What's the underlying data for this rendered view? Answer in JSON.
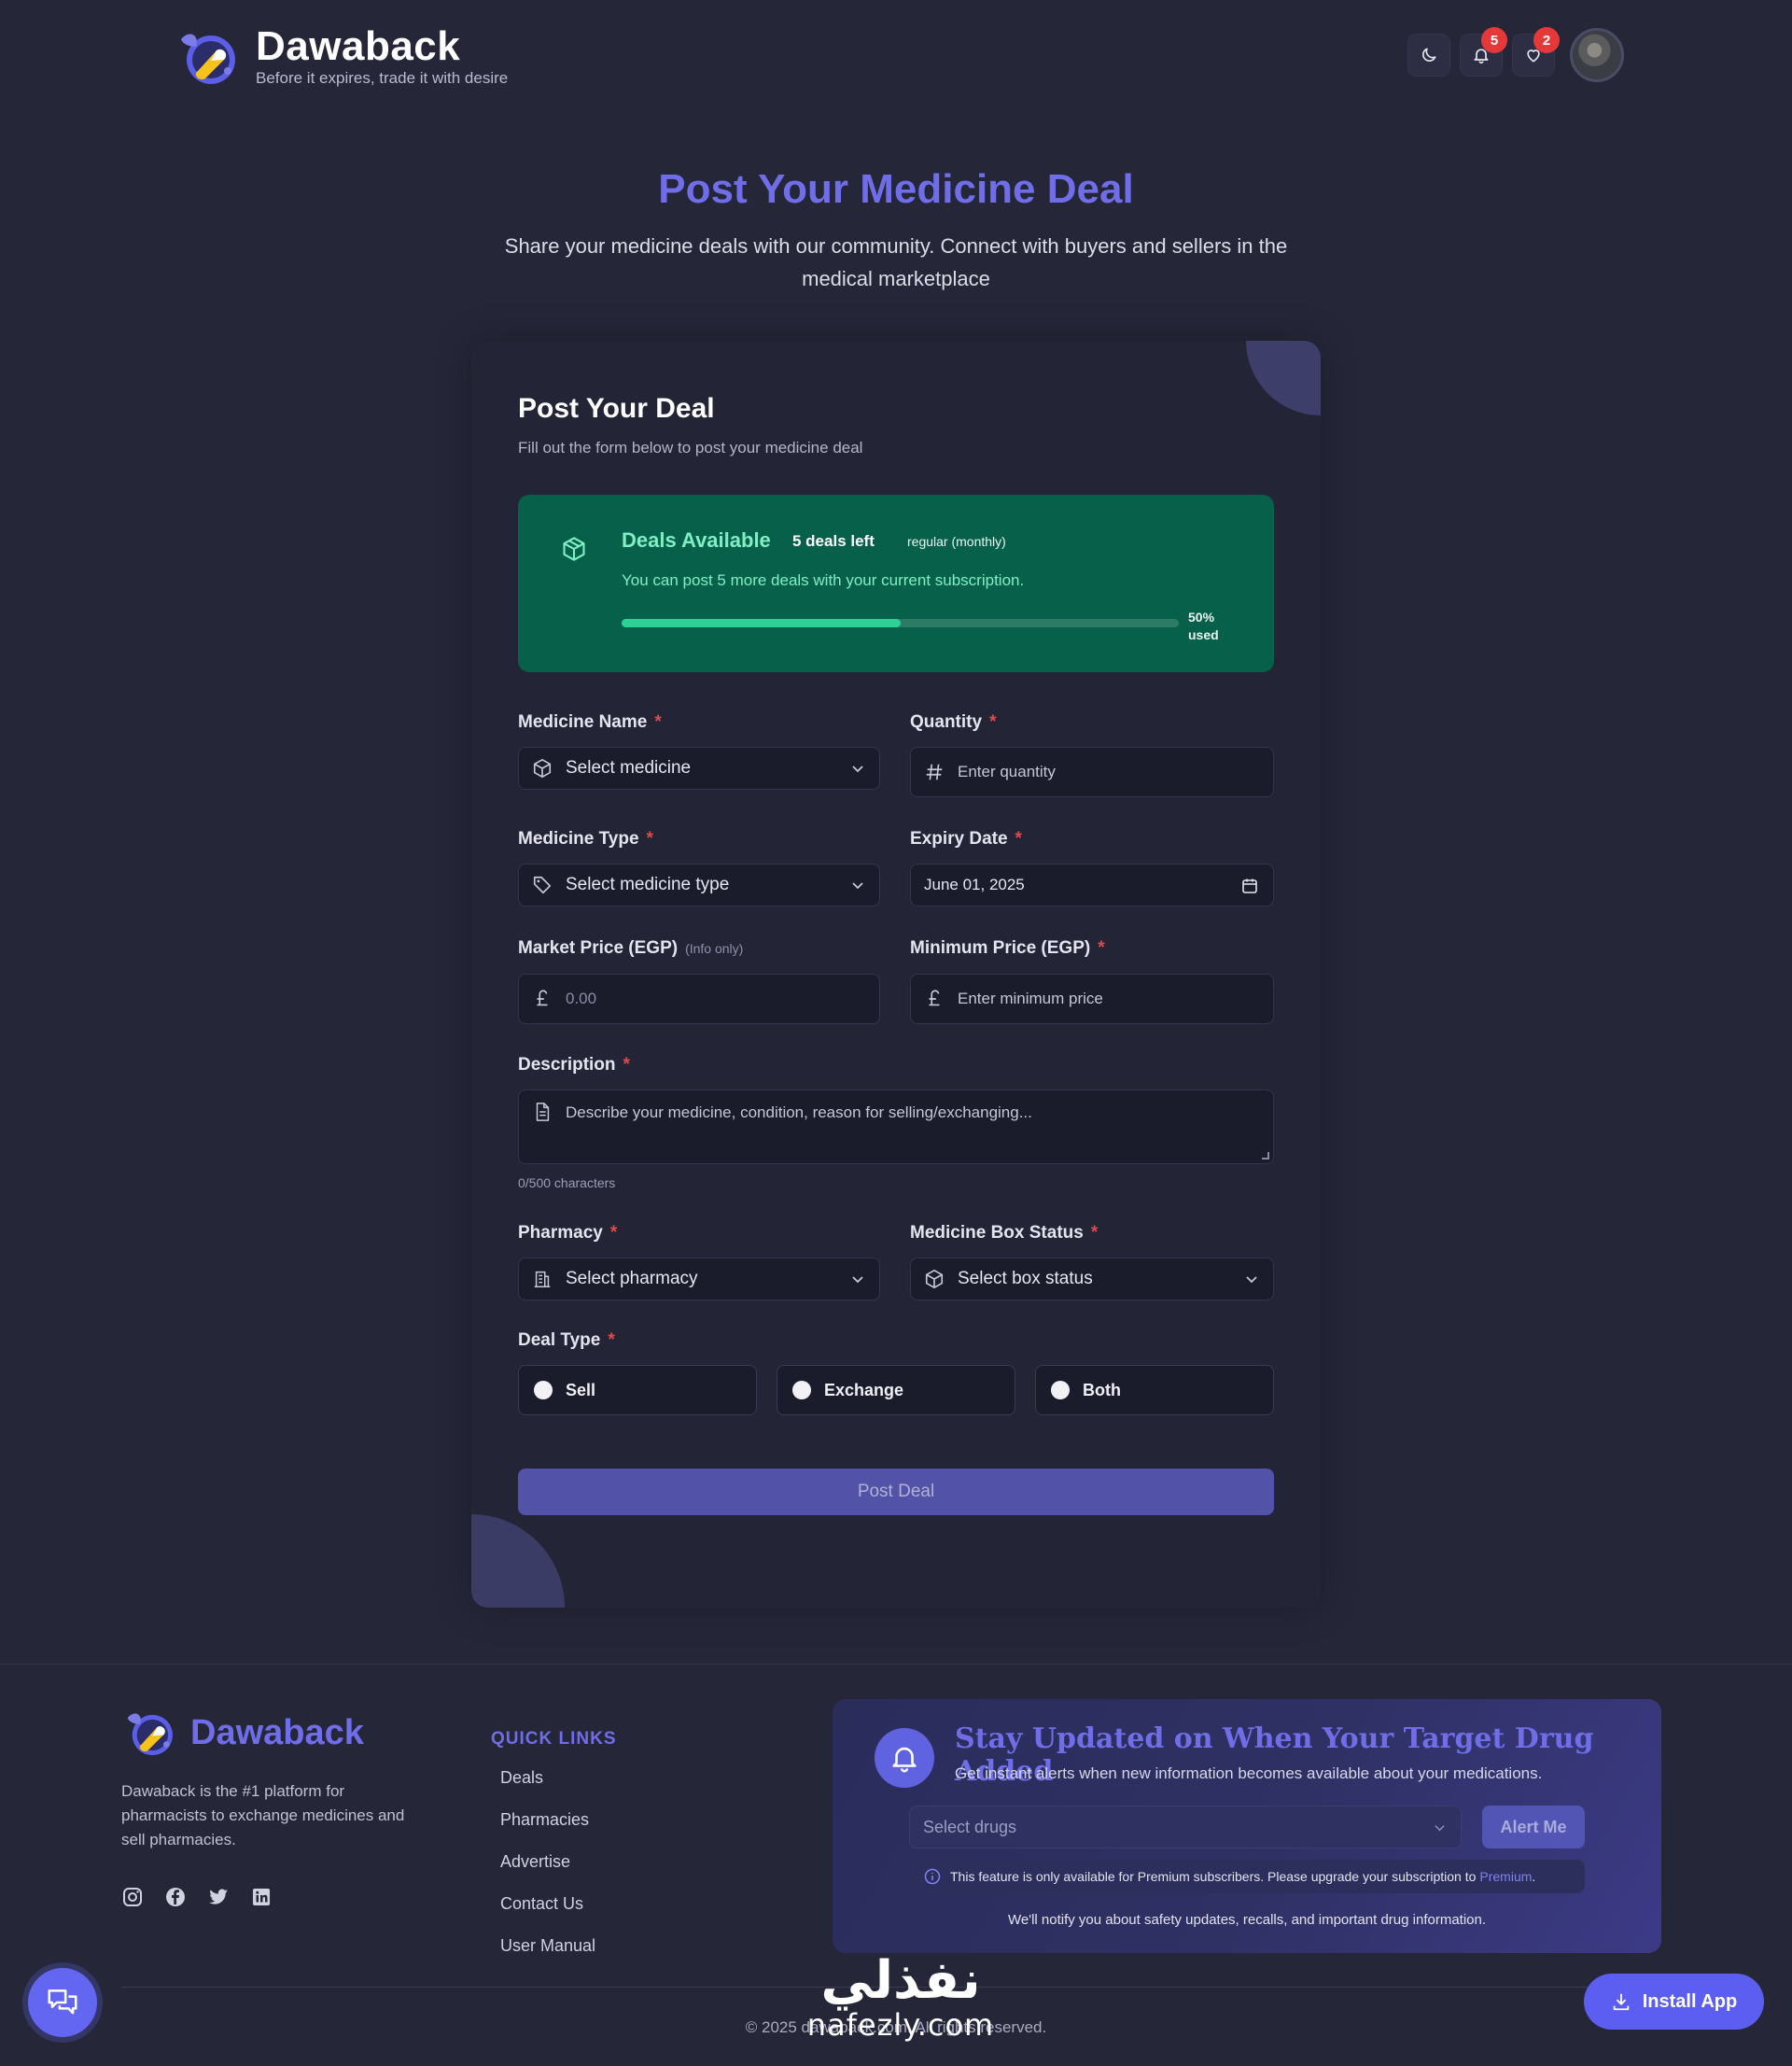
{
  "header": {
    "brand_name": "Dawaback",
    "tagline": "Before it expires, trade it with desire",
    "notifications_count": "5",
    "favorites_count": "2"
  },
  "hero": {
    "title": "Post Your Medicine Deal",
    "subtitle": "Share your medicine deals with our community. Connect with buyers and sellers in the medical marketplace"
  },
  "form": {
    "title": "Post Your Deal",
    "subtitle": "Fill out the form below to post your medicine deal",
    "deals": {
      "title": "Deals Available",
      "left": "5 deals left",
      "plan": "regular (monthly)",
      "description": "You can post 5 more deals with your current subscription.",
      "used_fraction": 0.5,
      "used_pct": "50%",
      "used_word": "used"
    },
    "required_mark": "*",
    "medicine_name": {
      "label": "Medicine Name",
      "value": "Select medicine"
    },
    "quantity": {
      "label": "Quantity",
      "placeholder": "Enter quantity"
    },
    "medicine_type": {
      "label": "Medicine Type",
      "value": "Select medicine type"
    },
    "expiry_date": {
      "label": "Expiry Date",
      "value": "June 01, 2025"
    },
    "market_price": {
      "label": "Market Price (EGP)",
      "hint": "(Info only)",
      "placeholder": "0.00"
    },
    "minimum_price": {
      "label": "Minimum Price (EGP)",
      "placeholder": "Enter minimum price"
    },
    "description": {
      "label": "Description",
      "placeholder": "Describe your medicine, condition, reason for selling/exchanging...",
      "char_count": "0/500 characters"
    },
    "pharmacy": {
      "label": "Pharmacy",
      "value": "Select pharmacy"
    },
    "box_status": {
      "label": "Medicine Box Status",
      "value": "Select box status"
    },
    "deal_type": {
      "label": "Deal Type",
      "options": [
        "Sell",
        "Exchange",
        "Both"
      ]
    },
    "submit_label": "Post Deal"
  },
  "footer": {
    "brand_name": "Dawaback",
    "description": "Dawaback is the #1 platform for pharmacists to exchange medicines and sell pharmacies.",
    "quick_links_title": "QUICK LINKS",
    "quick_links": [
      "Deals",
      "Pharmacies",
      "Advertise",
      "Contact Us",
      "User Manual"
    ],
    "alert": {
      "title": "Stay Updated on When Your Target Drug Added",
      "subtitle": "Get instant alerts when new information becomes available about your medications.",
      "select_placeholder": "Select drugs",
      "button_label": "Alert Me",
      "note": "This feature is only available for Premium subscribers. Please upgrade your subscription to",
      "note_link": "Premium",
      "note_end": ".",
      "foot": "We'll notify you about safety updates, recalls, and important drug information."
    },
    "copyright": "© 2025 dawaback.com. All rights reserved.",
    "watermark_ar": "نفذلي",
    "watermark_lat": "nafezly.com",
    "install_label": "Install App"
  },
  "colors": {
    "background": "#252638",
    "accent": "#6f6ee8",
    "deals_green": "#07604a",
    "progress_green": "#2fd095",
    "badge_red": "#e53939"
  }
}
